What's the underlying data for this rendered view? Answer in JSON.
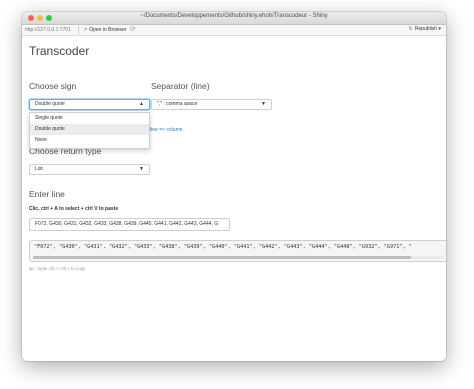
{
  "window": {
    "title": "~/Documents/Developpements/Github/shiny.ehoh/Transcodeur - Shiny"
  },
  "toolbar": {
    "url": "http://127.0.0.1:7701",
    "open_browser": "Open in Browser",
    "publish": "Republish"
  },
  "app": {
    "title": "Transcoder",
    "choose_sign": {
      "label": "Choose sign",
      "value": "Double quote",
      "options": [
        "Single quote",
        "Double quote",
        "None"
      ],
      "highlighted": "Double quote"
    },
    "separator": {
      "label": "Separator (line)",
      "value": "\",\" : comma space"
    },
    "link_text": "line => column",
    "return_type": {
      "label": "Choose return type",
      "value": "List"
    },
    "enter_line": {
      "label": "Enter line",
      "instruction": "Clic, ctrl + A to select + ctrl V to paste",
      "value": "F072, G430, G431, G432, G433, G438, G439, G440, G441, G442, G443, G444, G"
    },
    "output": "\"F072\", \"G430\", \"G431\", \"G432\", \"G433\", \"G438\", \"G439\", \"G440\", \"G441\", \"G442\", \"G443\", \"G444\", \"G448\", \"G932\", \"G971\", \"",
    "tip": "tip : triple clic + ctrl c to copy"
  }
}
